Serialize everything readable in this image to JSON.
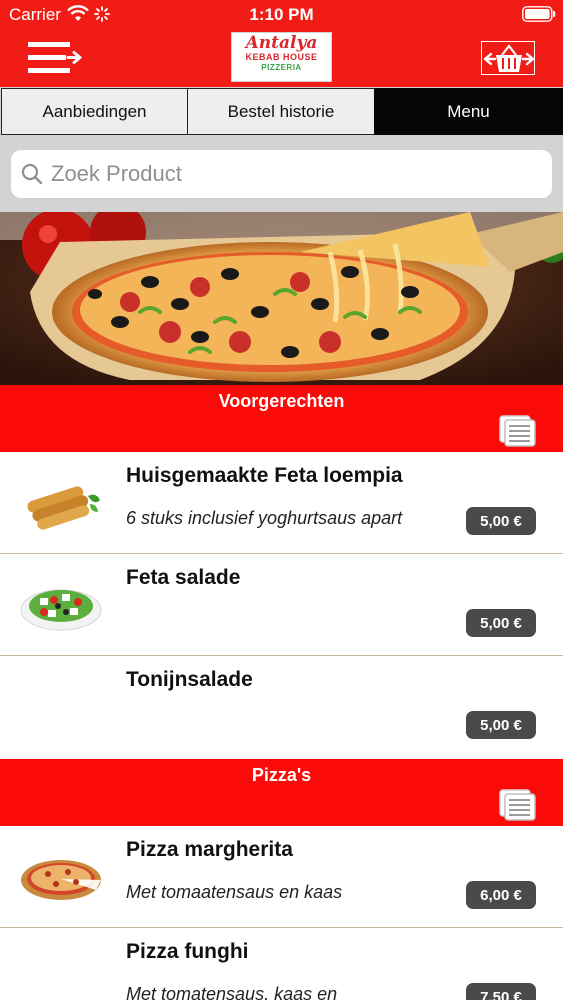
{
  "status_bar": {
    "carrier": "Carrier",
    "time": "1:10 PM"
  },
  "nav": {
    "logo_line1": "Antalya",
    "logo_line2": "KEBAB HOUSE",
    "logo_line3": "PIZZERIA",
    "menu_icon": "menu-arrow-icon",
    "cart_icon": "basket-arrows-icon"
  },
  "tabs": [
    {
      "label": "Aanbiedingen",
      "selected": false
    },
    {
      "label": "Bestel historie",
      "selected": false
    },
    {
      "label": "Menu",
      "selected": true
    }
  ],
  "search": {
    "placeholder": "Zoek Product"
  },
  "categories": [
    {
      "title": "Voorgerechten",
      "products": [
        {
          "name": "Huisgemaakte Feta loempia",
          "description": "6 stuks inclusief yoghurtsaus apart",
          "price": "5,00 €"
        },
        {
          "name": "Feta salade",
          "description": "",
          "price": "5,00 €"
        },
        {
          "name": "Tonijnsalade",
          "description": "",
          "price": "5,00 €"
        }
      ]
    },
    {
      "title": "Pizza's",
      "products": [
        {
          "name": "Pizza margherita",
          "description": "Met tomaatensaus en kaas",
          "price": "6,00 €"
        },
        {
          "name": "Pizza funghi",
          "description": "Met tomatensaus, kaas en",
          "price": "7,50 €"
        }
      ]
    }
  ],
  "colors": {
    "brand_red": "#f21c17",
    "category_red": "#fb0a0a",
    "price_badge": "#4a4a4a",
    "tab_selected": "#050505"
  }
}
